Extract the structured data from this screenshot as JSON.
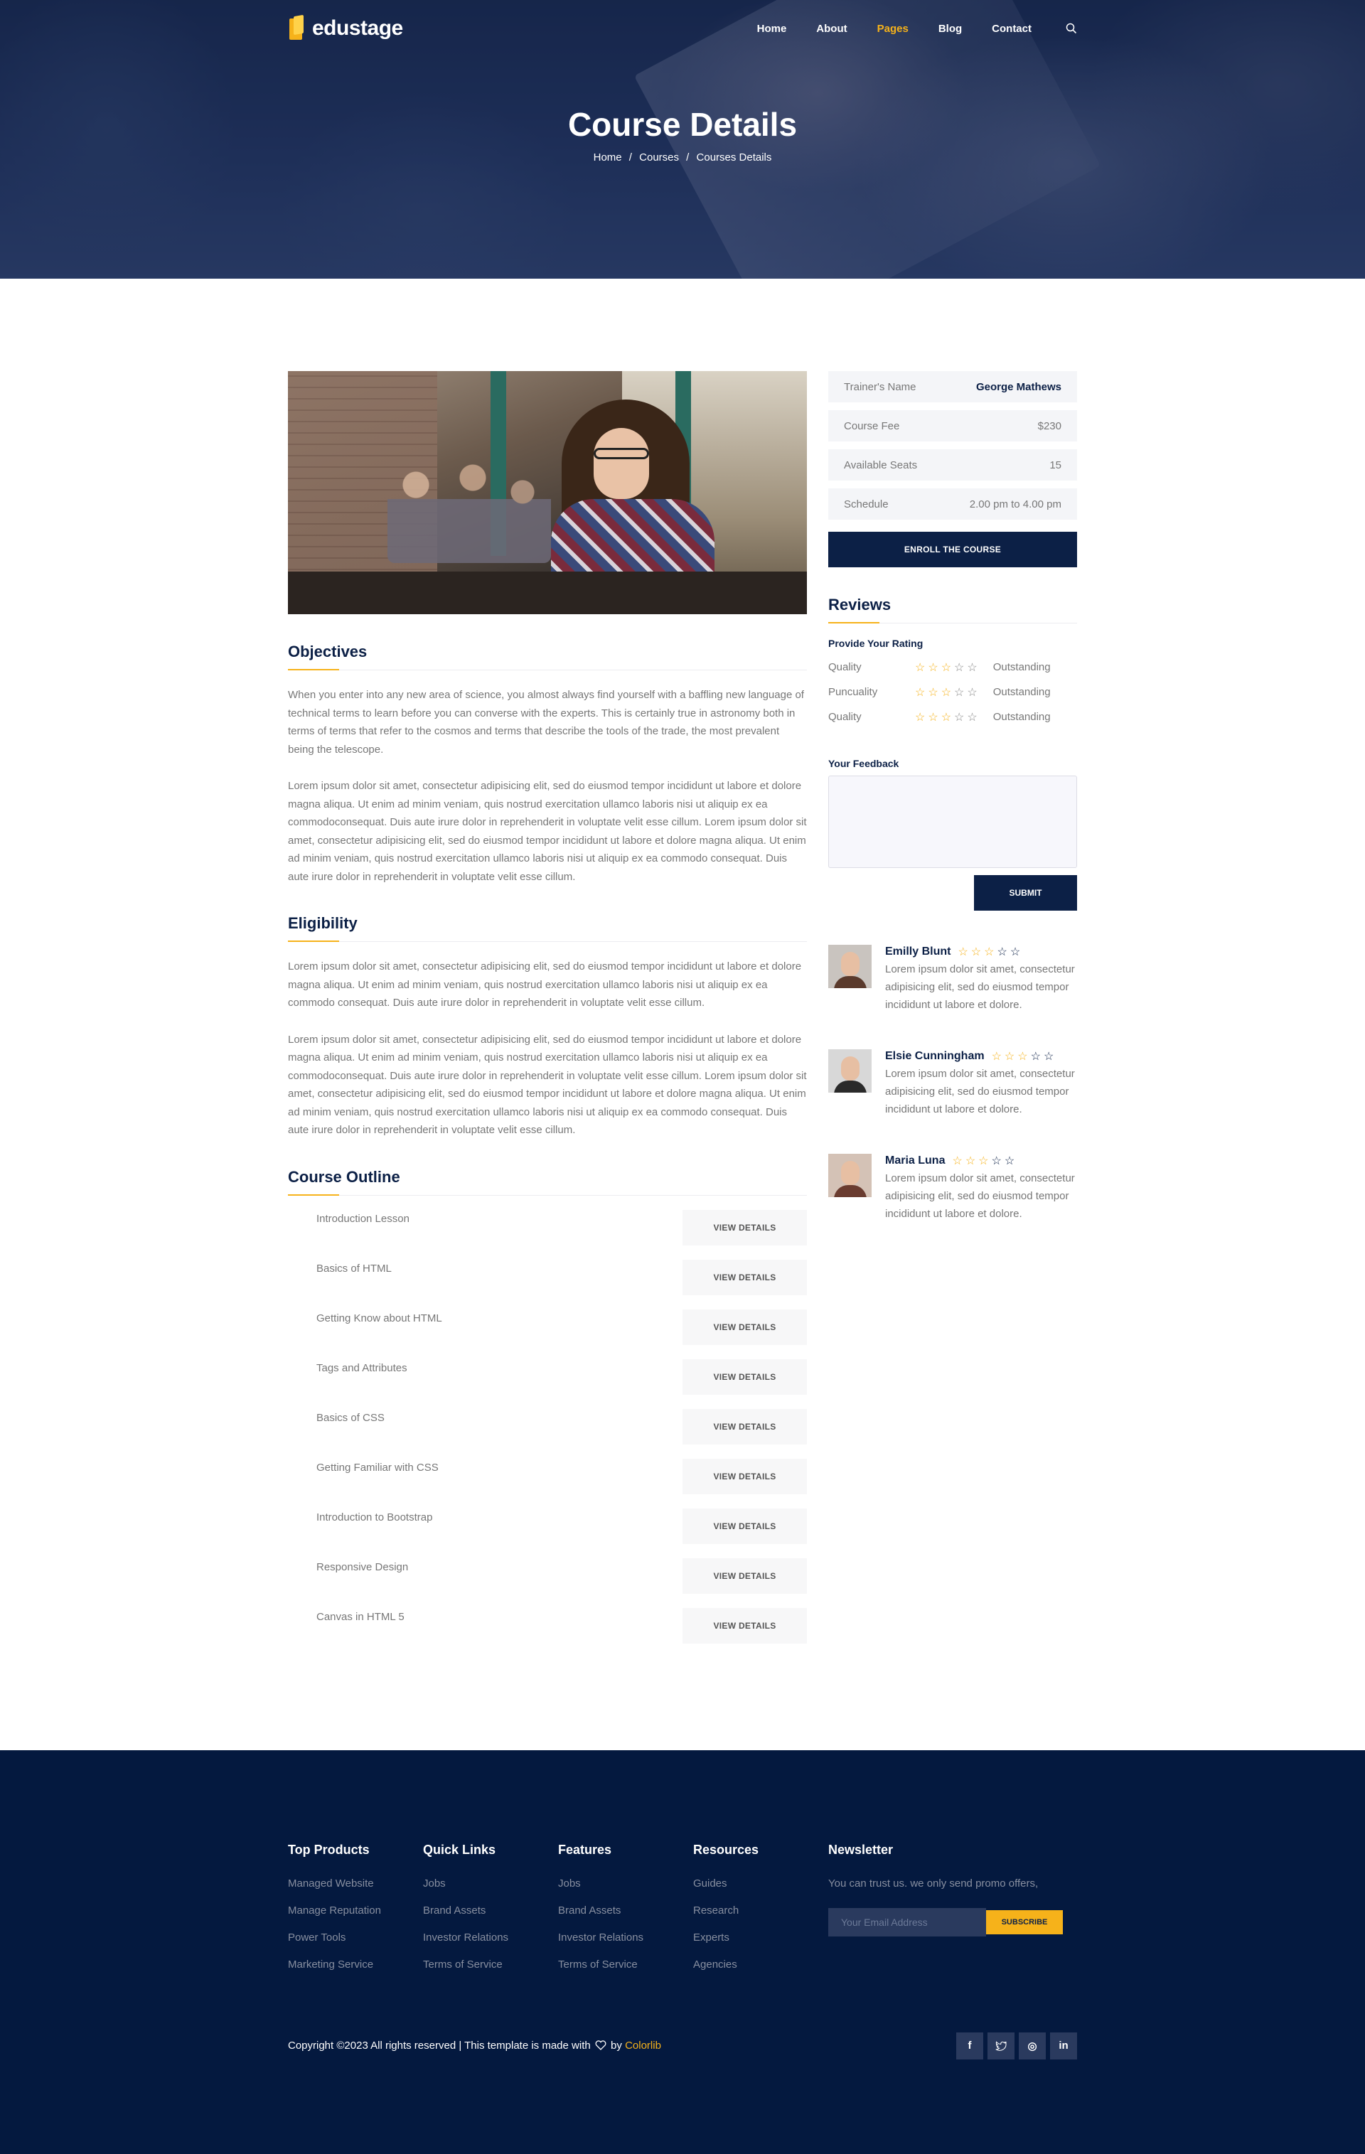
{
  "header": {
    "logo_text": "edustage",
    "nav": [
      {
        "label": "Home",
        "active": false
      },
      {
        "label": "About",
        "active": false
      },
      {
        "label": "Pages",
        "active": true
      },
      {
        "label": "Blog",
        "active": false
      },
      {
        "label": "Contact",
        "active": false
      }
    ],
    "search_icon": "search-icon"
  },
  "hero": {
    "title": "Course Details",
    "breadcrumb": [
      "Home",
      "Courses",
      "Courses Details"
    ],
    "separator": "/"
  },
  "objectives": {
    "title": "Objectives",
    "paragraphs": [
      "When you enter into any new area of science, you almost always find yourself with a baffling new language of technical terms to learn before you can converse with the experts. This is certainly true in astronomy both in terms of terms that refer to the cosmos and terms that describe the tools of the trade, the most prevalent being the telescope.",
      "Lorem ipsum dolor sit amet, consectetur adipisicing elit, sed do eiusmod tempor incididunt ut labore et dolore magna aliqua. Ut enim ad minim veniam, quis nostrud exercitation ullamco laboris nisi ut aliquip ex ea commodoconsequat. Duis aute irure dolor in reprehenderit in voluptate velit esse cillum. Lorem ipsum dolor sit amet, consectetur adipisicing elit, sed do eiusmod tempor incididunt ut labore et dolore magna aliqua. Ut enim ad minim veniam, quis nostrud exercitation ullamco laboris nisi ut aliquip ex ea commodo consequat. Duis aute irure dolor in reprehenderit in voluptate velit esse cillum."
    ]
  },
  "eligibility": {
    "title": "Eligibility",
    "paragraphs": [
      "Lorem ipsum dolor sit amet, consectetur adipisicing elit, sed do eiusmod tempor incididunt ut labore et dolore magna aliqua. Ut enim ad minim veniam, quis nostrud exercitation ullamco laboris nisi ut aliquip ex ea commodo consequat. Duis aute irure dolor in reprehenderit in voluptate velit esse cillum.",
      "Lorem ipsum dolor sit amet, consectetur adipisicing elit, sed do eiusmod tempor incididunt ut labore et dolore magna aliqua. Ut enim ad minim veniam, quis nostrud exercitation ullamco laboris nisi ut aliquip ex ea commodoconsequat. Duis aute irure dolor in reprehenderit in voluptate velit esse cillum. Lorem ipsum dolor sit amet, consectetur adipisicing elit, sed do eiusmod tempor incididunt ut labore et dolore magna aliqua. Ut enim ad minim veniam, quis nostrud exercitation ullamco laboris nisi ut aliquip ex ea commodo consequat. Duis aute irure dolor in reprehenderit in voluptate velit esse cillum."
    ]
  },
  "outline": {
    "title": "Course Outline",
    "button_label": "VIEW DETAILS",
    "items": [
      "Introduction Lesson",
      "Basics of HTML",
      "Getting Know about HTML",
      "Tags and Attributes",
      "Basics of CSS",
      "Getting Familiar with CSS",
      "Introduction to Bootstrap",
      "Responsive Design",
      "Canvas in HTML 5"
    ]
  },
  "course_info": {
    "rows": [
      {
        "key": "Trainer's Name",
        "value": "George Mathews"
      },
      {
        "key": "Course Fee",
        "value": "$230"
      },
      {
        "key": "Available Seats",
        "value": "15"
      },
      {
        "key": "Schedule",
        "value": "2.00 pm to 4.00 pm"
      }
    ],
    "enroll_label": "ENROLL THE COURSE"
  },
  "reviews": {
    "title": "Reviews",
    "provide_rating_label": "Provide Your Rating",
    "ratings": [
      {
        "label": "Quality",
        "stars": 3,
        "max": 5,
        "word": "Outstanding"
      },
      {
        "label": "Puncuality",
        "stars": 3,
        "max": 5,
        "word": "Outstanding"
      },
      {
        "label": "Quality",
        "stars": 3,
        "max": 5,
        "word": "Outstanding"
      }
    ],
    "feedback_label": "Your Feedback",
    "feedback_value": "",
    "submit_label": "SUBMIT",
    "items": [
      {
        "name": "Emilly Blunt",
        "stars": 3,
        "max": 5,
        "text": "Lorem ipsum dolor sit amet, consectetur adipisicing elit, sed do eiusmod tempor incididunt ut labore et dolore.",
        "avatar_color": "#5a3a2c"
      },
      {
        "name": "Elsie Cunningham",
        "stars": 3,
        "max": 5,
        "text": "Lorem ipsum dolor sit amet, consectetur adipisicing elit, sed do eiusmod tempor incididunt ut labore et dolore.",
        "avatar_color": "#2a2a2a"
      },
      {
        "name": "Maria Luna",
        "stars": 3,
        "max": 5,
        "text": "Lorem ipsum dolor sit amet, consectetur adipisicing elit, sed do eiusmod tempor incididunt ut labore et dolore.",
        "avatar_color": "#6a3c30"
      }
    ]
  },
  "footer": {
    "columns": [
      {
        "title": "Top Products",
        "links": [
          "Managed Website",
          "Manage Reputation",
          "Power Tools",
          "Marketing Service"
        ]
      },
      {
        "title": "Quick Links",
        "links": [
          "Jobs",
          "Brand Assets",
          "Investor Relations",
          "Terms of Service"
        ]
      },
      {
        "title": "Features",
        "links": [
          "Jobs",
          "Brand Assets",
          "Investor Relations",
          "Terms of Service"
        ]
      },
      {
        "title": "Resources",
        "links": [
          "Guides",
          "Research",
          "Experts",
          "Agencies"
        ]
      }
    ],
    "newsletter": {
      "title": "Newsletter",
      "text": "You can trust us. we only send promo offers,",
      "placeholder": "Your Email Address",
      "button_label": "SUBSCRIBE"
    },
    "copyright_prefix": "Copyright ©2023 All rights reserved | This template is made with",
    "copyright_by": "by",
    "copyright_brand": "Colorlib",
    "socials": [
      {
        "icon": "facebook-icon",
        "glyph": "f"
      },
      {
        "icon": "twitter-icon",
        "glyph": "t"
      },
      {
        "icon": "dribbble-icon",
        "glyph": "◎"
      },
      {
        "icon": "linkedin-icon",
        "glyph": "in"
      }
    ]
  },
  "colors": {
    "navy": "#0c2046",
    "accent": "#f6b21a",
    "footer_bg": "#04193f"
  }
}
